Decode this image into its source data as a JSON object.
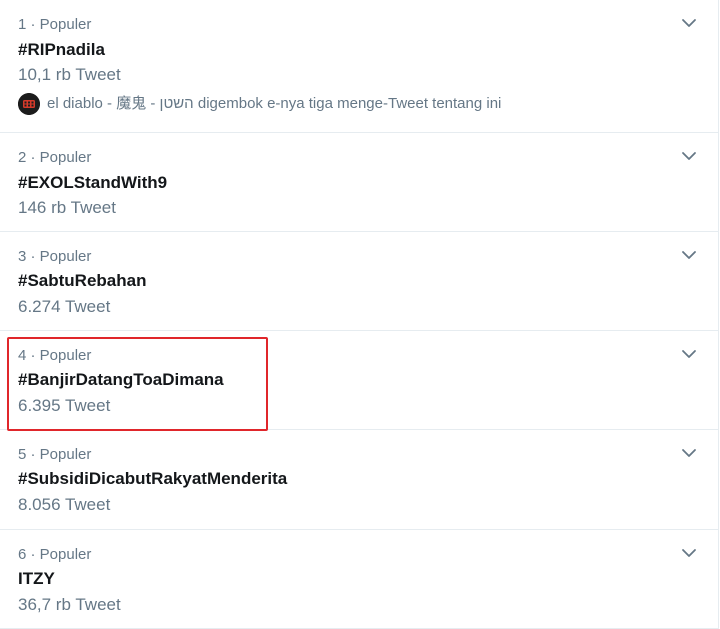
{
  "trends": [
    {
      "meta": "1 · Populer",
      "title": "#RIPnadila",
      "count": "10,1 rb Tweet",
      "context": "el diablo - 魔鬼 - השטן digembok e-nya tiga menge-Tweet tentang ini"
    },
    {
      "meta": "2 · Populer",
      "title": "#EXOLStandWith9",
      "count": "146 rb Tweet"
    },
    {
      "meta": "3 · Populer",
      "title": "#SabtuRebahan",
      "count": "6.274 Tweet"
    },
    {
      "meta": "4 · Populer",
      "title": "#BanjirDatangToaDimana",
      "count": "6.395 Tweet"
    },
    {
      "meta": "5 · Populer",
      "title": "#SubsidiDicabutRakyatMenderita",
      "count": "8.056 Tweet"
    },
    {
      "meta": "6 · Populer",
      "title": "ITZY",
      "count": "36,7 rb Tweet"
    }
  ],
  "colors": {
    "highlight": "#e0262b",
    "muted": "#657786",
    "text": "#14171a",
    "divider": "#e6ecf0"
  },
  "icons": {
    "chevron": "chevron-down-icon",
    "avatar": "user-avatar"
  }
}
